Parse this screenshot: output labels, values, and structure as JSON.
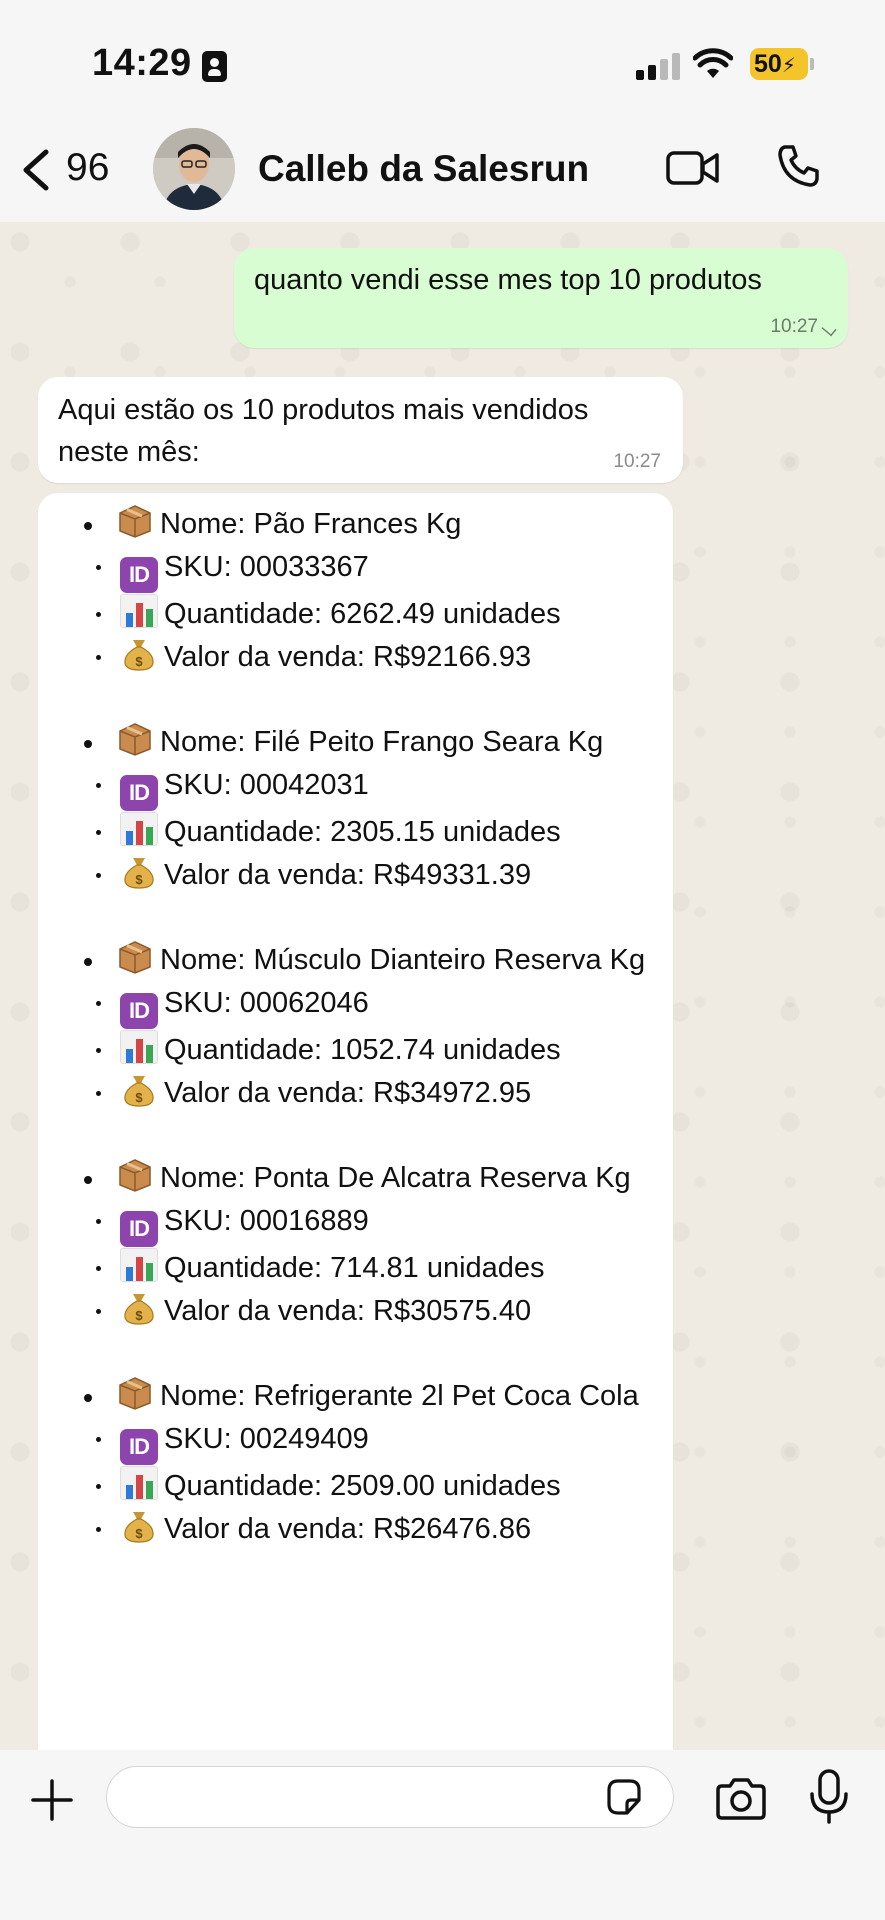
{
  "status_bar": {
    "time": "14:29",
    "battery": "50"
  },
  "header": {
    "back_count": "96",
    "contact_name": "Calleb da Salesrun"
  },
  "messages": {
    "outgoing": {
      "text": "quanto vendi esse mes top 10 produtos",
      "time": "10:27"
    },
    "incoming_intro": {
      "text": "Aqui estão os 10 produtos mais vendidos neste mês:",
      "time": "10:27"
    },
    "products": [
      {
        "name": "Nome: Pão Frances Kg",
        "sku": "SKU: 00033367",
        "qty": "Quantidade: 6262.49 unidades",
        "value": "Valor da venda: R$92166.93"
      },
      {
        "name": "Nome: Filé Peito Frango Seara Kg",
        "sku": "SKU: 00042031",
        "qty": "Quantidade: 2305.15 unidades",
        "value": "Valor da venda: R$49331.39"
      },
      {
        "name": "Nome: Músculo Dianteiro Reserva Kg",
        "sku": "SKU: 00062046",
        "qty": "Quantidade: 1052.74 unidades",
        "value": "Valor da venda: R$34972.95"
      },
      {
        "name": "Nome: Ponta De Alcatra Reserva Kg",
        "sku": "SKU: 00016889",
        "qty": "Quantidade: 714.81 unidades",
        "value": "Valor da venda: R$30575.40"
      },
      {
        "name": "Nome: Refrigerante 2l Pet Coca Cola",
        "sku": "SKU: 00249409",
        "qty": "Quantidade: 2509.00 unidades",
        "value": "Valor da venda: R$26476.86"
      }
    ]
  },
  "input": {
    "placeholder": ""
  },
  "icons": {
    "id_emoji_text": "ID"
  },
  "colors": {
    "outgoing_bubble": "#d9fdd3",
    "incoming_bubble": "#ffffff",
    "chat_background": "#efeae2",
    "battery": "#f4c52a",
    "id_emoji": "#8e44ad"
  }
}
